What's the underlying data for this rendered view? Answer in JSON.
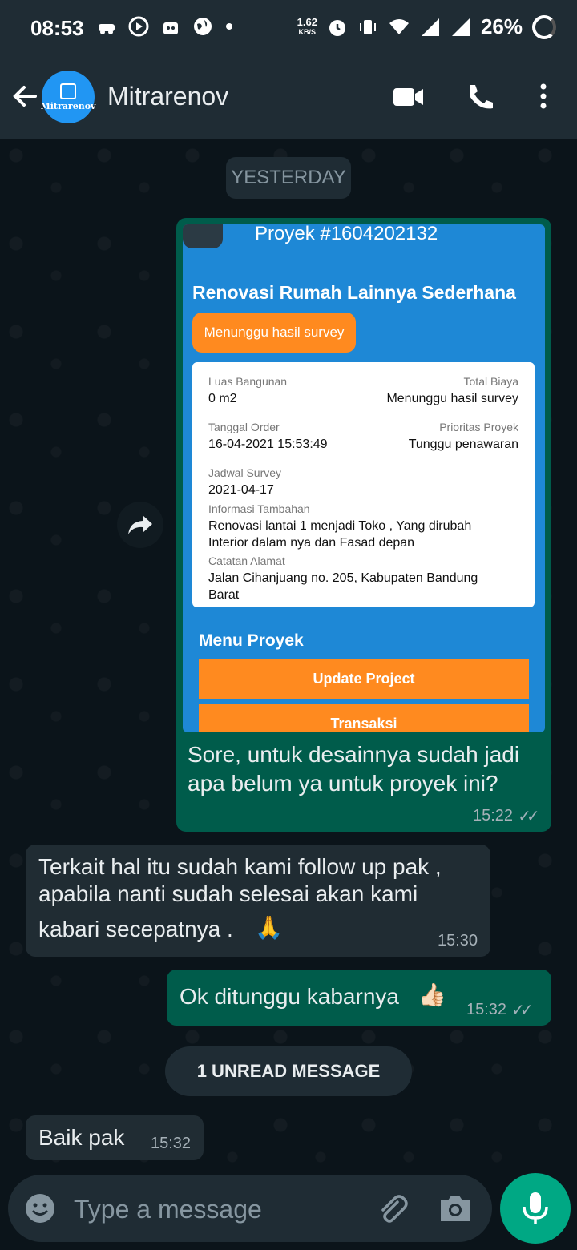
{
  "status_bar": {
    "time": "08:53",
    "net_speed": "1.62",
    "net_unit": "KB/S",
    "battery": "26%"
  },
  "header": {
    "contact_name": "Mitrarenov",
    "avatar_text": "Mitrarenov"
  },
  "chat": {
    "date_separator": "YESTERDAY",
    "card": {
      "project_id": "Proyek #1604202132",
      "title": "Renovasi Rumah Lainnya Sederhana",
      "status": "Menunggu hasil survey",
      "luas_label": "Luas Bangunan",
      "luas_value": "0 m2",
      "total_label": "Total Biaya",
      "total_value": "Menunggu hasil survey",
      "tanggal_label": "Tanggal Order",
      "tanggal_value": "16-04-2021 15:53:49",
      "prioritas_label": "Prioritas Proyek",
      "prioritas_value": "Tunggu penawaran",
      "jadwal_label": "Jadwal Survey",
      "jadwal_value": "2021-04-17",
      "info_label": "Informasi Tambahan",
      "info_value_1": "Renovasi lantai 1 menjadi Toko , Yang dirubah",
      "info_value_2": "Interior dalam nya dan Fasad depan",
      "alamat_label": "Catatan Alamat",
      "alamat_value_1": "Jalan Cihanjuang no. 205, Kabupaten Bandung",
      "alamat_value_2": "Barat",
      "menu_title": "Menu Proyek",
      "btn_update": "Update Project",
      "btn_transaksi": "Transaksi"
    },
    "messages": [
      {
        "direction": "out",
        "line1": "Sore, untuk desainnya sudah jadi",
        "line2": "apa belum ya untuk proyek ini?",
        "time": "15:22",
        "ticks": "✓✓"
      },
      {
        "direction": "in",
        "line1": "Terkait hal itu sudah kami follow up pak ,",
        "line2": "apabila nanti sudah selesai akan kami",
        "line3": "kabari secepatnya .",
        "emoji": "🙏",
        "time": "15:30"
      },
      {
        "direction": "out",
        "line1": "Ok ditunggu kabarnya",
        "emoji": "👍🏻",
        "time": "15:32",
        "ticks": "✓✓"
      },
      {
        "direction": "in",
        "line1": "Baik pak",
        "time": "15:32"
      }
    ],
    "unread_label": "1 UNREAD MESSAGE"
  },
  "composer": {
    "placeholder": "Type a message"
  },
  "colors": {
    "outgoing_bubble": "#005c4b",
    "incoming_bubble": "#202c33",
    "accent": "#00a884",
    "card_blue": "#1e88d6",
    "card_orange": "#ff8a1f"
  },
  "icons": [
    "back-arrow-icon",
    "video-call-icon",
    "phone-icon",
    "more-options-icon",
    "forward-icon",
    "emoji-icon",
    "attach-icon",
    "camera-icon",
    "mic-icon"
  ]
}
